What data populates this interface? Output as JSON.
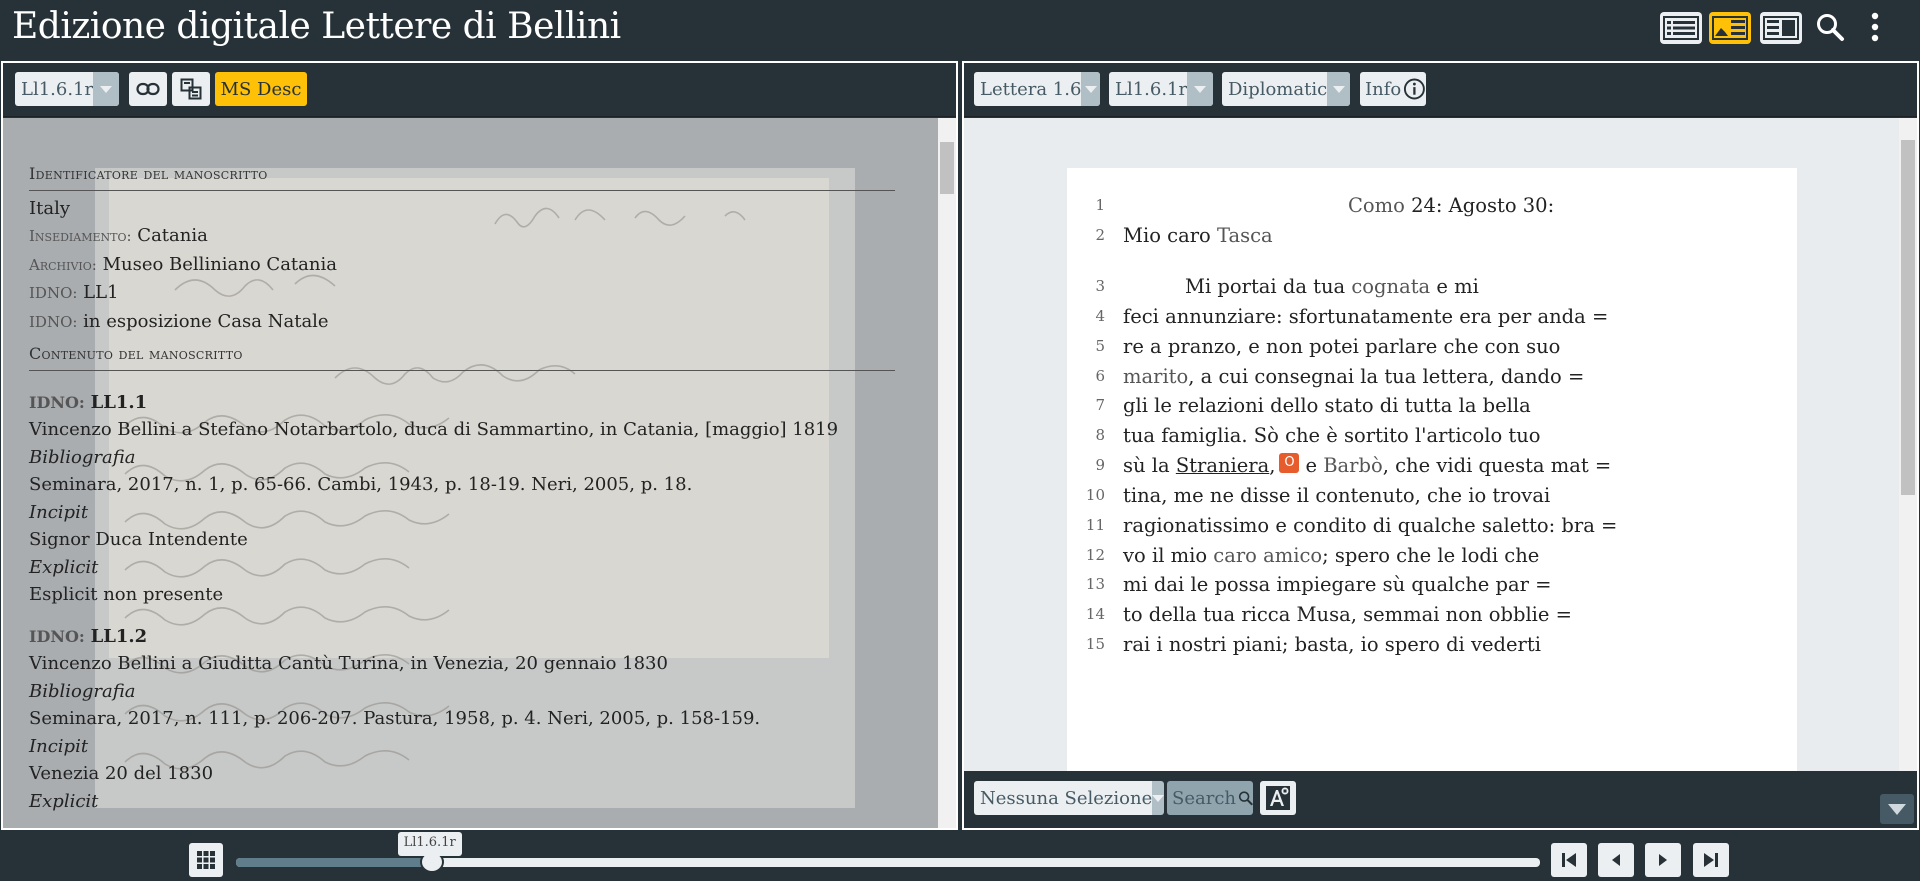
{
  "header": {
    "title": "Edizione digitale Lettere di Bellini",
    "icons": [
      "image-text-mode-icon",
      "image-image-mode-icon",
      "text-text-mode-icon",
      "search-icon",
      "kebab-menu-icon"
    ],
    "active_mode": "image-text"
  },
  "left_panel": {
    "page_select": "Ll1.6.1r",
    "link_icon": "link-icon",
    "toggle_icon": "toggle-views-icon",
    "msdesc_button": "MS Desc",
    "msdesc": {
      "identifier_title": "Identificatore del manoscritto",
      "country": "Italy",
      "settlement_label": "Insediamento:",
      "settlement": "Catania",
      "repository_label": "Archivio:",
      "repository": "Museo Belliniano Catania",
      "idno_label": "IDNO:",
      "idno_1": "LL1",
      "idno_2_label": "IDNO:",
      "idno_2": "in esposizione Casa Natale",
      "contents_title": "Contenuto del manoscritto",
      "items": [
        {
          "idno_label": "IDNO:",
          "idno": "LL1.1",
          "title": "Vincenzo Bellini a Stefano Notarbartolo, duca di Sammartino, in Catania, [maggio] 1819",
          "biblio_label": "Bibliografia",
          "biblio": "Seminara, 2017, n. 1, p. 65-66. Cambi, 1943, p. 18-19. Neri, 2005, p. 18.",
          "incipit_label": "Incipit",
          "incipit": "Signor Duca Intendente",
          "explicit_label": "Explicit",
          "explicit": "Esplicit non presente"
        },
        {
          "idno_label": "IDNO:",
          "idno": "LL1.2",
          "title": "Vincenzo Bellini a Giuditta Cantù Turina, in Venezia, 20 gennaio 1830",
          "biblio_label": "Bibliografia",
          "biblio": "Seminara, 2017, n. 111, p. 206-207. Pastura, 1958, p. 4. Neri, 2005, p. 158-159.",
          "incipit_label": "Incipit",
          "incipit": "Venezia 20 del 1830",
          "explicit_label": "Explicit"
        }
      ]
    }
  },
  "right_panel": {
    "doc_select": "Lettera 1.6",
    "page_select": "Ll1.6.1r",
    "edition_select": "Diplomatic",
    "info_button": "Info",
    "info_icon": "info-circle-icon",
    "lines": [
      {
        "n": "1",
        "parts": [
          {
            "t": "Como",
            "c": "place"
          },
          {
            "t": " 24: Agosto 30:"
          }
        ]
      },
      {
        "n": "2",
        "parts": [
          {
            "t": "Mio caro "
          },
          {
            "t": "Tasca",
            "c": "person"
          }
        ]
      },
      {
        "n": "3",
        "parts": [
          {
            "t": "Mi portai da tua "
          },
          {
            "t": "cognata",
            "c": "person"
          },
          {
            "t": " e mi"
          }
        ]
      },
      {
        "n": "4",
        "parts": [
          {
            "t": "feci annunziare: sfortunatamente era per anda ="
          }
        ]
      },
      {
        "n": "5",
        "parts": [
          {
            "t": "re a pranzo, e non potei parlare che con suo"
          }
        ]
      },
      {
        "n": "6",
        "parts": [
          {
            "t": "marito",
            "c": "person"
          },
          {
            "t": ", a cui consegnai la tua lettera, dando ="
          }
        ]
      },
      {
        "n": "7",
        "parts": [
          {
            "t": "gli le relazioni dello stato di tutta la bella"
          }
        ]
      },
      {
        "n": "8",
        "parts": [
          {
            "t": "tua famiglia. Sò che è sortito l'articolo tuo"
          }
        ]
      },
      {
        "n": "9",
        "parts": [
          {
            "t": "sù la "
          },
          {
            "t": "Straniera",
            "c": "ul"
          },
          {
            "t": ","
          },
          {
            "badge": "O"
          },
          {
            "t": "e "
          },
          {
            "t": "Barbò",
            "c": "person"
          },
          {
            "t": ", che vidi questa mat ="
          }
        ]
      },
      {
        "n": "10",
        "parts": [
          {
            "t": "tina, me ne disse il contenuto, che io trovai"
          }
        ]
      },
      {
        "n": "11",
        "parts": [
          {
            "t": "ragionatissimo e condito di qualche saletto: bra ="
          }
        ]
      },
      {
        "n": "12",
        "parts": [
          {
            "t": "vo il mio "
          },
          {
            "t": "caro amico",
            "c": "person"
          },
          {
            "t": "; spero che le lodi che"
          }
        ]
      },
      {
        "n": "13",
        "parts": [
          {
            "t": "mi dai le possa impiegare sù qualche par ="
          }
        ]
      },
      {
        "n": "14",
        "parts": [
          {
            "t": "to della tua ricca Musa, semmai non obblie ="
          }
        ]
      },
      {
        "n": "15",
        "parts": [
          {
            "t": "rai i nostri piani; basta, io spero di vederti"
          }
        ]
      }
    ],
    "filter_select": "Nessuna Selezione",
    "search_button": "Search",
    "search_icon": "search-icon",
    "font_icon": "font-size-icon",
    "collapse_icon": "chevron-down-icon"
  },
  "bottom_bar": {
    "thumbs_icon": "grid-thumbnails-icon",
    "slider_label": "Ll1.6.1r",
    "slider_position": 0.15,
    "nav_icons": [
      "first-page-icon",
      "previous-page-icon",
      "next-page-icon",
      "last-page-icon"
    ]
  }
}
